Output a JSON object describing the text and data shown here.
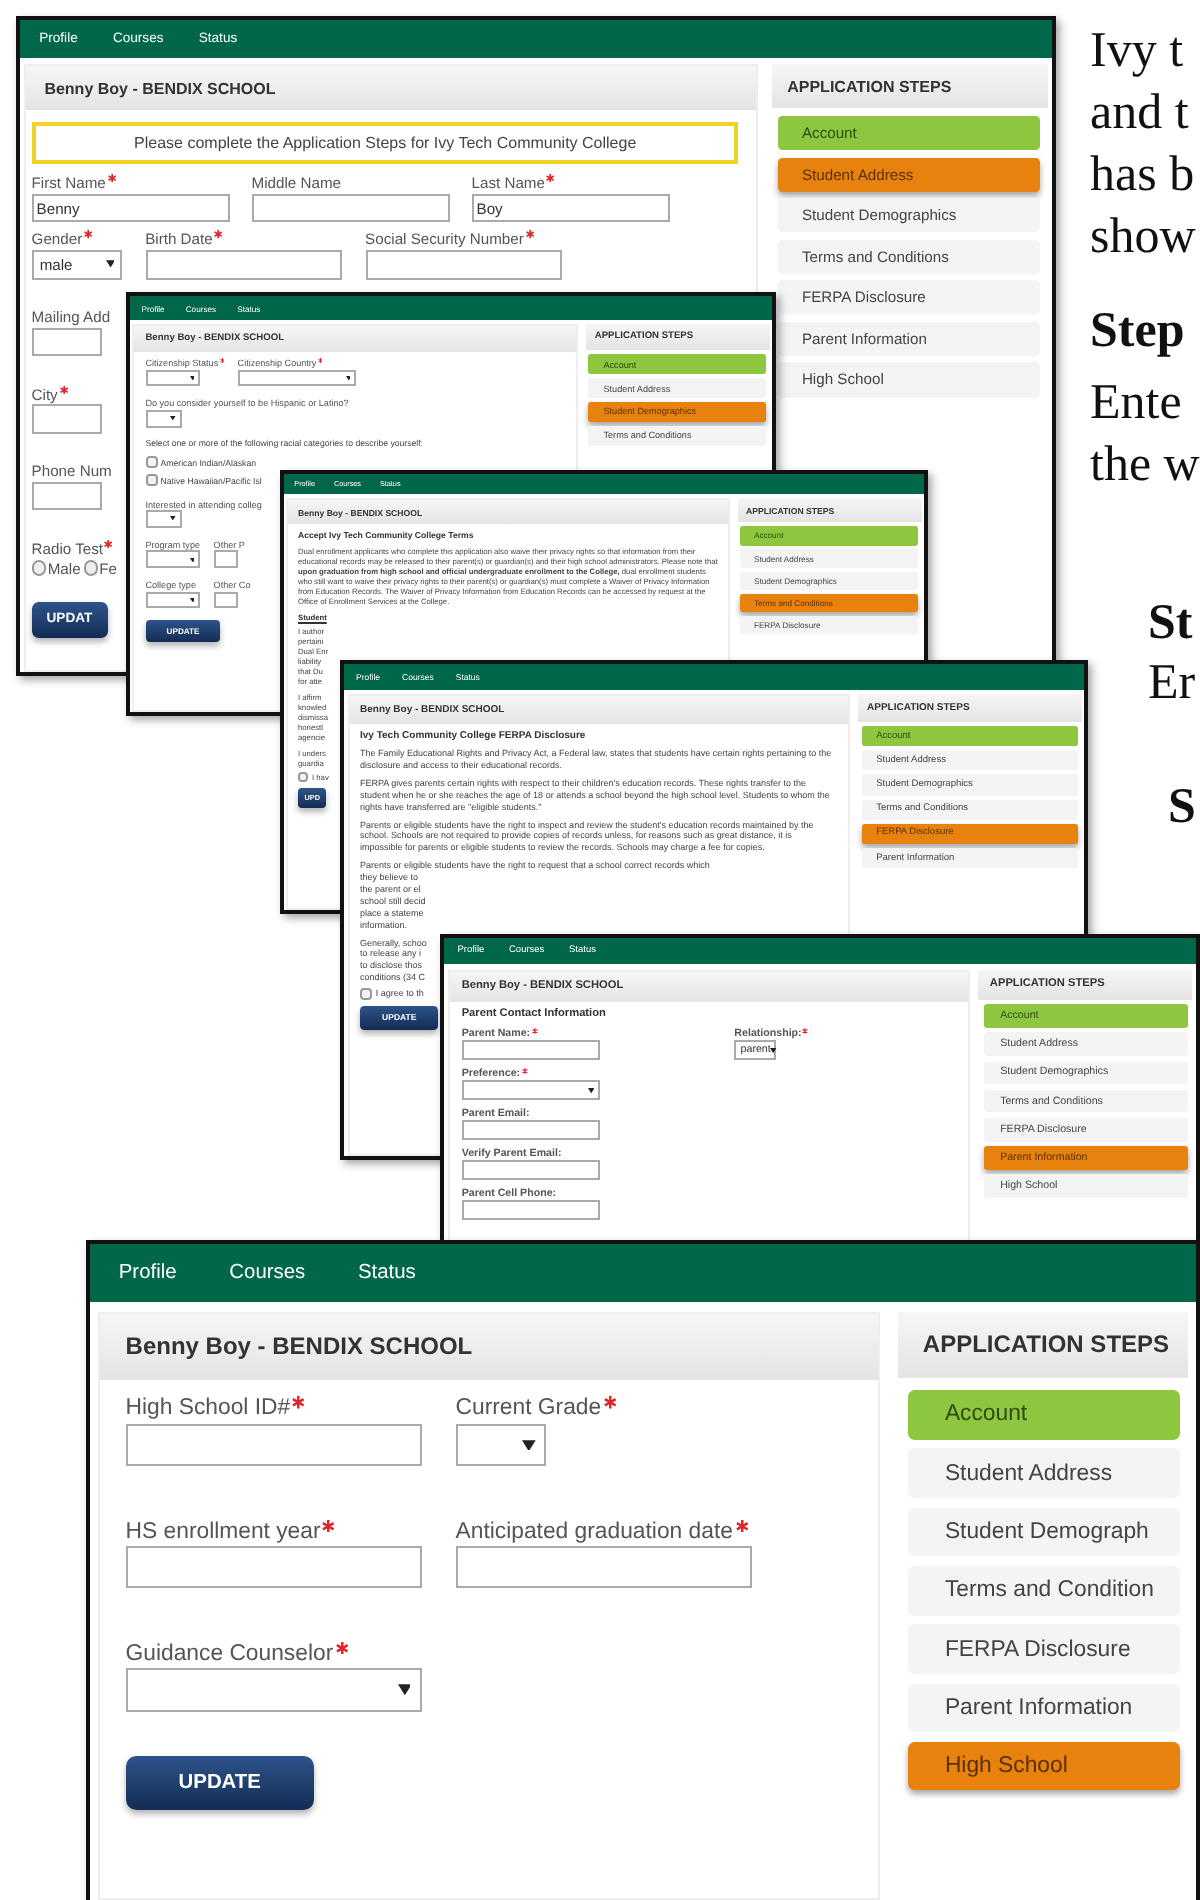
{
  "windows": [
    {
      "nav": [
        "Profile",
        "Courses",
        "Status"
      ],
      "header": "Benny Boy - BENDIX SCHOOL",
      "steps_title": "APPLICATION STEPS",
      "steps": [
        {
          "label": "Account",
          "completed": true,
          "selected": false
        },
        {
          "label": "Student Address",
          "completed": false,
          "selected": true
        },
        {
          "label": "Student Demographics",
          "completed": false,
          "selected": false
        },
        {
          "label": "Terms and Conditions",
          "completed": false,
          "selected": false
        },
        {
          "label": "FERPA Disclosure",
          "completed": false,
          "selected": false
        },
        {
          "label": "Parent Information",
          "completed": false,
          "selected": false
        },
        {
          "label": "High School",
          "completed": false,
          "selected": false
        }
      ],
      "content": [
        {
          "kind": "notice",
          "text": "Please complete the Application Steps for Ivy Tech Community College"
        },
        {
          "kind": "fields",
          "fields": [
            {
              "label": "First Name",
              "required": true,
              "kind": "input",
              "value": "Benny"
            },
            {
              "label": "Middle Name",
              "required": false,
              "kind": "input"
            },
            {
              "label": "Last Name",
              "required": true,
              "kind": "input",
              "value": "Boy"
            }
          ]
        },
        {
          "kind": "fields",
          "fields": [
            {
              "label": "Gender",
              "required": true,
              "kind": "select",
              "value": "male"
            },
            {
              "label": "Birth Date",
              "required": true,
              "kind": "input"
            },
            {
              "label": "Social Security Number",
              "required": true,
              "kind": "input"
            }
          ]
        },
        {
          "kind": "fields",
          "fields": [
            {
              "label": "Mailing Add",
              "required": false,
              "kind": "input"
            }
          ]
        },
        {
          "kind": "fields",
          "fields": [
            {
              "label": "City",
              "required": true,
              "kind": "input"
            }
          ]
        },
        {
          "kind": "fields",
          "fields": [
            {
              "label": "Phone Num",
              "required": false,
              "kind": "input"
            }
          ]
        },
        {
          "kind": "radios",
          "label": "Radio Test",
          "required": true,
          "options": [
            {
              "label": "Male",
              "selected": false
            },
            {
              "label": "Fe",
              "selected": false
            }
          ]
        },
        {
          "kind": "button",
          "label": "UPDAT"
        }
      ]
    },
    {
      "nav": [
        "Profile",
        "Courses",
        "Status"
      ],
      "header": "Benny Boy - BENDIX SCHOOL",
      "steps_title": "APPLICATION STEPS",
      "steps": [
        {
          "label": "Account",
          "completed": true,
          "selected": false
        },
        {
          "label": "Student Address",
          "completed": false,
          "selected": false
        },
        {
          "label": "Student Demographics",
          "completed": false,
          "selected": true
        },
        {
          "label": "Terms and Conditions",
          "completed": false,
          "selected": false
        }
      ],
      "content": [
        {
          "kind": "fields",
          "fields": [
            {
              "label": "Citizenship Status",
              "required": true,
              "kind": "select"
            },
            {
              "label": "Citizenship Country",
              "required": true,
              "kind": "wide-select"
            }
          ]
        },
        {
          "kind": "fields",
          "fields": [
            {
              "label": "Do you consider yourself to be Hispanic or Latino?",
              "required": false,
              "kind": "short-select"
            }
          ]
        },
        {
          "kind": "text",
          "text": "Select one or more of the following racial categories to describe yourself:"
        },
        {
          "kind": "checkbox",
          "label": "American Indian/Alaskan",
          "checked": false
        },
        {
          "kind": "checkbox",
          "label": "Native Hawaiian/Pacific Isl",
          "checked": false
        },
        {
          "kind": "fields",
          "fields": [
            {
              "label": "Interested in attending colleg",
              "required": false,
              "kind": "short-select"
            }
          ]
        },
        {
          "kind": "fields",
          "fields": [
            {
              "label": "Program type",
              "required": false,
              "kind": "select"
            },
            {
              "label": "Other P",
              "required": false,
              "kind": "input"
            }
          ]
        },
        {
          "kind": "fields",
          "fields": [
            {
              "label": "College type",
              "required": false,
              "kind": "select"
            },
            {
              "label": "Other Co",
              "required": false,
              "kind": "input"
            }
          ]
        },
        {
          "kind": "button",
          "label": "UPDATE"
        }
      ]
    },
    {
      "nav": [
        "Profile",
        "Courses",
        "Status"
      ],
      "header": "Benny Boy - BENDIX SCHOOL",
      "steps_title": "APPLICATION STEPS",
      "steps": [
        {
          "label": "Account",
          "completed": true,
          "selected": false
        },
        {
          "label": "Student Address",
          "completed": false,
          "selected": false
        },
        {
          "label": "Student Demographics",
          "completed": false,
          "selected": false
        },
        {
          "label": "Terms and Conditions",
          "completed": false,
          "selected": true
        },
        {
          "label": "FERPA Disclosure",
          "completed": false,
          "selected": false
        }
      ],
      "content": [
        {
          "kind": "heading",
          "text": "Accept Ivy Tech Community College Terms"
        },
        {
          "kind": "paragraph",
          "text": "Dual enrollment applicants who complete this application also waive their privacy rights so that information from their educational records may be released to their parent(s) or guardian(s) and their high school administrators. Please note that **upon graduation from high school and official undergraduate enrollment to the College,** dual enrollment students who still want to waive their privacy rights to their parent(s) or guardian(s) must complete a Waiver of Privacy Information from Education Records. The Waiver of Privacy Information from Education Records can be accessed by request at the Office of Enrollment Services at the College."
        },
        {
          "kind": "subheading",
          "text": "Student"
        },
        {
          "kind": "lines",
          "text": "I author\npertaini\nDual Enr\nliability\nthat Du\nfor atte"
        },
        {
          "kind": "lines",
          "text": "I affirm\nknowled\ndismissa\nhonestl\nagencie"
        },
        {
          "kind": "lines",
          "text": "I unders\nguardia"
        },
        {
          "kind": "checkbox",
          "label": "I hav",
          "checked": false
        },
        {
          "kind": "button",
          "label": "UPD"
        }
      ]
    },
    {
      "nav": [
        "Profile",
        "Courses",
        "Status"
      ],
      "header": "Benny Boy - BENDIX SCHOOL",
      "steps_title": "APPLICATION STEPS",
      "steps": [
        {
          "label": "Account",
          "completed": true,
          "selected": false
        },
        {
          "label": "Student Address",
          "completed": false,
          "selected": false
        },
        {
          "label": "Student Demographics",
          "completed": false,
          "selected": false
        },
        {
          "label": "Terms and Conditions",
          "completed": false,
          "selected": false
        },
        {
          "label": "FERPA Disclosure",
          "completed": false,
          "selected": true
        },
        {
          "label": "Parent Information",
          "completed": false,
          "selected": false
        }
      ],
      "content": [
        {
          "kind": "heading",
          "text": "Ivy Tech Community College FERPA Disclosure"
        },
        {
          "kind": "paragraph",
          "text": "The Family Educational Rights and Privacy Act, a Federal law, states that students have certain rights pertaining to the disclosure and access to their educational records."
        },
        {
          "kind": "paragraph",
          "text": "FERPA gives parents certain rights with respect to their children's education records. These rights transfer to the student when he or she reaches the age of 18 or attends a school beyond the high school level. Students to whom the rights have transferred are \"eligible students.\""
        },
        {
          "kind": "paragraph",
          "text": "Parents or eligible students have the right to inspect and review the student's education records maintained by the school. Schools are not required to provide copies of records unless, for reasons such as great distance, it is impossible for parents or eligible students to review the records. Schools may charge a fee for copies."
        },
        {
          "kind": "lines",
          "text": "Parents or eligible students have the right to request that a school correct records which\nthey believe to\nthe parent or el\nschool still decid\nplace a stateme\ninformation."
        },
        {
          "kind": "lines",
          "text": "Generally, schoo\nto release any i\nto disclose thos\nconditions (34 C"
        },
        {
          "kind": "checkbox",
          "label": "I agree to th",
          "checked": false
        },
        {
          "kind": "button",
          "label": "UPDATE"
        }
      ]
    },
    {
      "nav": [
        "Profile",
        "Courses",
        "Status"
      ],
      "header": "Benny Boy - BENDIX SCHOOL",
      "steps_title": "APPLICATION STEPS",
      "steps": [
        {
          "label": "Account",
          "completed": true,
          "selected": false
        },
        {
          "label": "Student Address",
          "completed": false,
          "selected": false
        },
        {
          "label": "Student Demographics",
          "completed": false,
          "selected": false
        },
        {
          "label": "Terms and Conditions",
          "completed": false,
          "selected": false
        },
        {
          "label": "FERPA Disclosure",
          "completed": false,
          "selected": false
        },
        {
          "label": "Parent Information",
          "completed": false,
          "selected": true
        },
        {
          "label": "High School",
          "completed": false,
          "selected": false
        }
      ],
      "content": [
        {
          "kind": "heading",
          "text": "Parent Contact Information"
        },
        {
          "kind": "fields",
          "fields": [
            {
              "label": "Parent Name:",
              "required": true,
              "kind": "input"
            },
            {
              "label": "Relationship:",
              "required": true,
              "kind": "short-select",
              "value": "parent"
            }
          ]
        },
        {
          "kind": "fields",
          "fields": [
            {
              "label": "Preference:",
              "required": true,
              "kind": "wide-select"
            }
          ]
        },
        {
          "kind": "fields",
          "fields": [
            {
              "label": "Parent Email:",
              "required": false,
              "kind": "input"
            }
          ]
        },
        {
          "kind": "fields",
          "fields": [
            {
              "label": "Verify Parent Email:",
              "required": false,
              "kind": "input"
            }
          ]
        },
        {
          "kind": "fields",
          "fields": [
            {
              "label": "Parent Cell Phone:",
              "required": false,
              "kind": "input"
            }
          ]
        }
      ]
    },
    {
      "nav": [
        "Profile",
        "Courses",
        "Status"
      ],
      "header": "Benny Boy - BENDIX SCHOOL",
      "steps_title": "APPLICATION STEPS",
      "steps": [
        {
          "label": "Account",
          "completed": true,
          "selected": false
        },
        {
          "label": "Student Address",
          "completed": false,
          "selected": false
        },
        {
          "label": "Student Demograph",
          "completed": false,
          "selected": false
        },
        {
          "label": "Terms and Condition",
          "completed": false,
          "selected": false
        },
        {
          "label": "FERPA Disclosure",
          "completed": false,
          "selected": false
        },
        {
          "label": "Parent Information",
          "completed": false,
          "selected": false
        },
        {
          "label": "High School",
          "completed": false,
          "selected": true
        }
      ],
      "content": [
        {
          "kind": "fields",
          "fields": [
            {
              "label": "High School ID#",
              "required": true,
              "kind": "input"
            },
            {
              "label": "Current Grade",
              "required": true,
              "kind": "short-select"
            }
          ]
        },
        {
          "kind": "fields",
          "fields": [
            {
              "label": "HS enrollment year",
              "required": true,
              "kind": "input"
            },
            {
              "label": "Anticipated graduation date",
              "required": true,
              "kind": "input"
            }
          ]
        },
        {
          "kind": "fields",
          "fields": [
            {
              "label": "Guidance Counselor",
              "required": true,
              "kind": "wide-select"
            }
          ]
        },
        {
          "kind": "button",
          "label": "UPDATE"
        }
      ]
    }
  ],
  "document_text": [
    {
      "kind": "paragraph",
      "text": "Ivy t\nand t\nhas b\nshow"
    },
    {
      "kind": "heading",
      "text": "Step"
    },
    {
      "kind": "paragraph",
      "text": "Ente\nthe w"
    },
    {
      "kind": "heading",
      "text": "St"
    },
    {
      "kind": "paragraph",
      "text": "Er"
    },
    {
      "kind": "heading",
      "text": "S"
    }
  ]
}
